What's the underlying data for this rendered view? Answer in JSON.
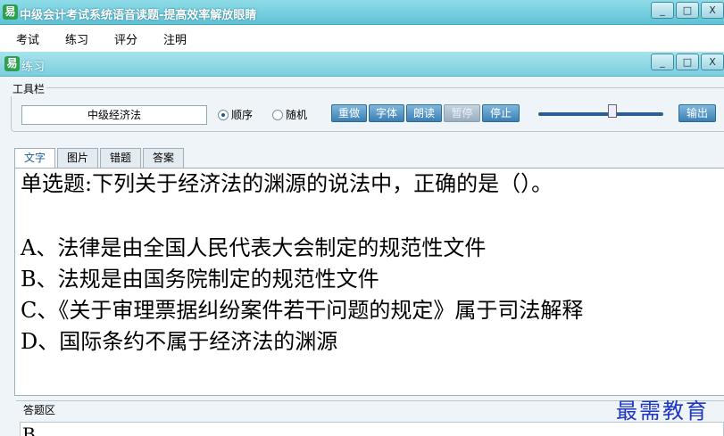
{
  "window": {
    "title": "中级会计考试系统语音读题-提高效率解放眼睛",
    "icon": "app-icon",
    "buttons": [
      "_",
      "□",
      "X"
    ]
  },
  "menu": [
    "考试",
    "练习",
    "评分",
    "注明"
  ],
  "child": {
    "title": "练习",
    "icon": "app-icon",
    "buttons": [
      "_",
      "□",
      "X"
    ]
  },
  "toolbar": {
    "label": "工具栏",
    "subject": "中级经济法",
    "order_label": "顺序",
    "random_label": "随机",
    "order_selected": true,
    "buttons": {
      "reset": "重做",
      "font": "字体",
      "read": "朗读",
      "pause": "暂停",
      "stop": "停止",
      "export": "输出"
    },
    "volume_level": 0.56
  },
  "tabs": [
    "文字",
    "图片",
    "错题",
    "答案"
  ],
  "question": {
    "stem": "单选题:下列关于经济法的渊源的说法中，正确的是（）。",
    "options": [
      "A、法律是由全国人民代表大会制定的规范性文件",
      "B、法规是由国务院制定的规范性文件",
      "C、《关于审理票据纠纷案件若干问题的规定》属于司法解释",
      "D、国际条约不属于经济法的渊源"
    ]
  },
  "answer": {
    "label": "答题区",
    "value": "B"
  },
  "watermark": "最需教育"
}
